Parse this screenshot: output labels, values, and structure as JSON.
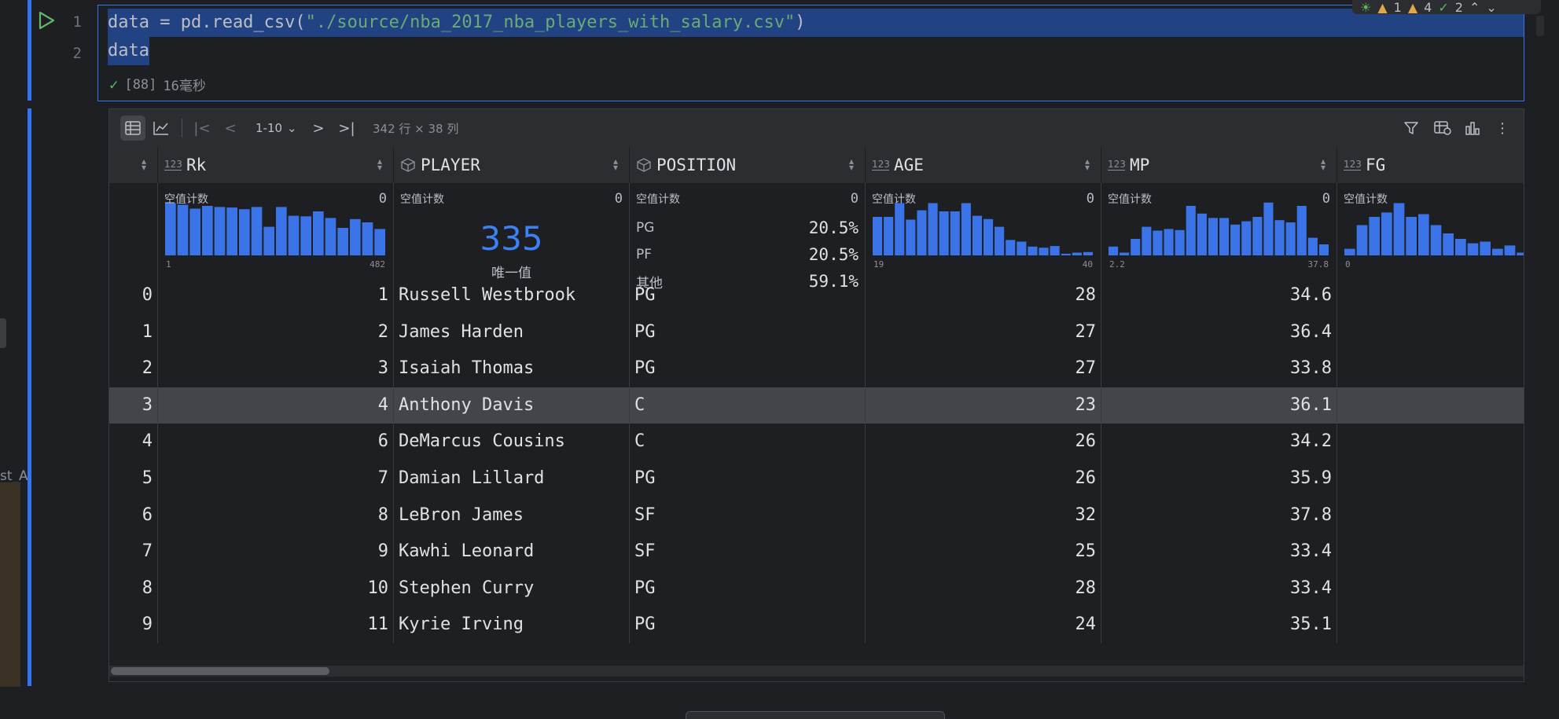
{
  "left_panel": {
    "partial_text": "st_A"
  },
  "code_cell": {
    "line_numbers": [
      "1",
      "2"
    ],
    "line1": {
      "prefix": "data = pd.read_csv(",
      "string": "\"./source/nba_2017_nba_players_with_salary.csv\"",
      "suffix": ")"
    },
    "line2": "data",
    "exec_count": "[88]",
    "exec_time": "16毫秒"
  },
  "inspections": {
    "errors": "1",
    "warnings": "4",
    "weak_warnings": "2"
  },
  "toolbar": {
    "page_range": "1-10",
    "shape_info": "342 行 × 38 列"
  },
  "columns": [
    {
      "name": "",
      "type": ""
    },
    {
      "name": "Rk",
      "type": "123"
    },
    {
      "name": "PLAYER",
      "type": "object"
    },
    {
      "name": "POSITION",
      "type": "object"
    },
    {
      "name": "AGE",
      "type": "123"
    },
    {
      "name": "MP",
      "type": "123"
    },
    {
      "name": "FG",
      "type": "123"
    }
  ],
  "summary": {
    "null_label": "空值计数",
    "rk": {
      "null_count": "0",
      "min": "1",
      "max": "482",
      "hist": [
        0.95,
        0.92,
        0.85,
        0.9,
        0.88,
        0.87,
        0.84,
        0.88,
        0.52,
        0.88,
        0.72,
        0.71,
        0.8,
        0.68,
        0.5,
        0.66,
        0.6,
        0.48
      ]
    },
    "player": {
      "null_count": "0",
      "unique": "335",
      "unique_label": "唯一值"
    },
    "position": {
      "null_count": "0",
      "categories": [
        {
          "name": "PG",
          "pct": "20.5%"
        },
        {
          "name": "PF",
          "pct": "20.5%"
        },
        {
          "name": "其他",
          "pct": "59.1%"
        }
      ]
    },
    "age": {
      "null_count": "0",
      "min": "19",
      "max": "40",
      "hist": [
        0.7,
        0.7,
        0.95,
        0.65,
        0.82,
        0.95,
        0.8,
        0.8,
        0.95,
        0.72,
        0.66,
        0.52,
        0.28,
        0.25,
        0.16,
        0.14,
        0.17,
        0.03,
        0.05,
        0.06
      ]
    },
    "mp": {
      "null_count": "0",
      "min": "2.2",
      "max": "37.8",
      "hist": [
        0.16,
        0.05,
        0.3,
        0.52,
        0.45,
        0.48,
        0.46,
        0.9,
        0.76,
        0.68,
        0.68,
        0.56,
        0.62,
        0.7,
        0.96,
        0.64,
        0.6,
        0.9,
        0.32,
        0.2
      ]
    },
    "fg": {
      "null_count": "0",
      "min": "0",
      "hist": [
        0.12,
        0.55,
        0.7,
        0.78,
        0.95,
        0.7,
        0.75,
        0.55,
        0.4,
        0.3,
        0.22,
        0.25,
        0.12,
        0.18,
        0.05,
        0.1,
        0.06,
        0.1
      ]
    }
  },
  "rows": [
    {
      "idx": "0",
      "rk": "1",
      "player": "Russell Westbrook",
      "position": "PG",
      "age": "28",
      "mp": "34.6"
    },
    {
      "idx": "1",
      "rk": "2",
      "player": "James Harden",
      "position": "PG",
      "age": "27",
      "mp": "36.4"
    },
    {
      "idx": "2",
      "rk": "3",
      "player": "Isaiah Thomas",
      "position": "PG",
      "age": "27",
      "mp": "33.8"
    },
    {
      "idx": "3",
      "rk": "4",
      "player": "Anthony Davis",
      "position": "C",
      "age": "23",
      "mp": "36.1"
    },
    {
      "idx": "4",
      "rk": "6",
      "player": "DeMarcus Cousins",
      "position": "C",
      "age": "26",
      "mp": "34.2"
    },
    {
      "idx": "5",
      "rk": "7",
      "player": "Damian Lillard",
      "position": "PG",
      "age": "26",
      "mp": "35.9"
    },
    {
      "idx": "6",
      "rk": "8",
      "player": "LeBron James",
      "position": "SF",
      "age": "32",
      "mp": "37.8"
    },
    {
      "idx": "7",
      "rk": "9",
      "player": "Kawhi Leonard",
      "position": "SF",
      "age": "25",
      "mp": "33.4"
    },
    {
      "idx": "8",
      "rk": "10",
      "player": "Stephen Curry",
      "position": "PG",
      "age": "28",
      "mp": "33.4"
    },
    {
      "idx": "9",
      "rk": "11",
      "player": "Kyrie Irving",
      "position": "PG",
      "age": "24",
      "mp": "35.1"
    }
  ],
  "selected_row": 3,
  "colors": {
    "accent": "#3574f0",
    "hist_bar": "#3b74e8",
    "success": "#5fb865",
    "string": "#6aab73",
    "selection": "#214283"
  },
  "icons": {
    "run": "run-triangle-icon",
    "check": "check-icon",
    "table": "table-view-icon",
    "chart": "line-chart-icon",
    "first": "first-page-icon",
    "prev": "prev-page-icon",
    "next": "next-page-icon",
    "last": "last-page-icon",
    "filter": "filter-icon",
    "columns": "columns-settings-icon",
    "bar": "bar-chart-icon",
    "more": "more-vertical-icon"
  }
}
